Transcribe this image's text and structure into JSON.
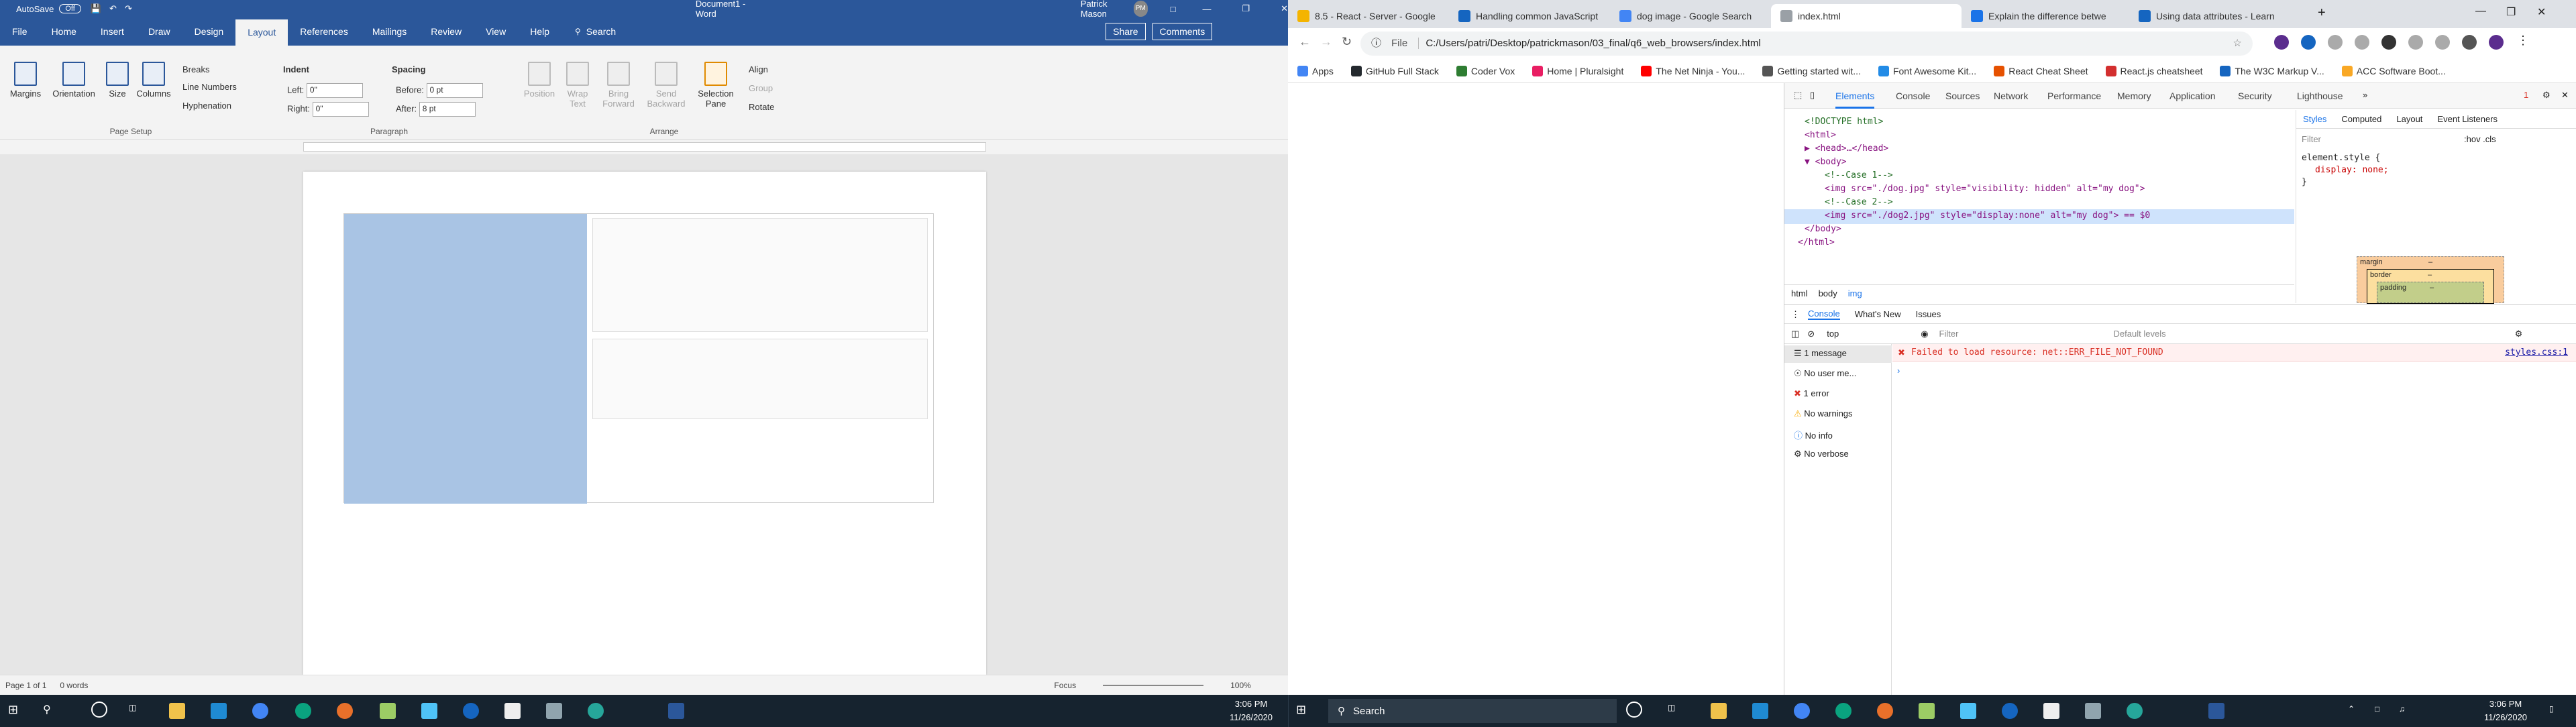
{
  "word": {
    "autosave_label": "AutoSave",
    "autosave_state": "Off",
    "doc_title": "Document1 - Word",
    "user_name": "Patrick Mason",
    "user_initials": "PM",
    "menu_tabs": [
      "File",
      "Home",
      "Insert",
      "Draw",
      "Design",
      "Layout",
      "References",
      "Mailings",
      "Review",
      "View",
      "Help"
    ],
    "search_label": "Search",
    "share_label": "Share",
    "comments_label": "Comments",
    "ribbon": {
      "margins": "Margins",
      "orientation": "Orientation",
      "size": "Size",
      "columns": "Columns",
      "breaks": "Breaks",
      "line_numbers": "Line Numbers",
      "hyphenation": "Hyphenation",
      "page_setup": "Page Setup",
      "indent": "Indent",
      "left": "Left:",
      "right": "Right:",
      "left_val": "0\"",
      "right_val": "0\"",
      "spacing": "Spacing",
      "before": "Before:",
      "after": "After:",
      "before_val": "0 pt",
      "after_val": "8 pt",
      "paragraph": "Paragraph",
      "position": "Position",
      "wrap_text": "Wrap Text",
      "bring_forward": "Bring Forward",
      "send_backward": "Send Backward",
      "selection_pane": "Selection Pane",
      "align": "Align",
      "group": "Group",
      "rotate": "Rotate",
      "arrange": "Arrange"
    },
    "status": {
      "page": "Page 1 of 1",
      "words": "0 words",
      "focus": "Focus",
      "zoom": "100%"
    }
  },
  "chrome": {
    "tabs": [
      {
        "label": "8.5 - React - Server - Google",
        "color": "#f4b400"
      },
      {
        "label": "Handling common JavaScript",
        "color": "#1565c0"
      },
      {
        "label": "dog image - Google Search",
        "color": "#4285f4"
      },
      {
        "label": "index.html",
        "color": "#9aa0a6"
      },
      {
        "label": "Explain the difference betwe",
        "color": "#1a73e8"
      },
      {
        "label": "Using data attributes - Learn",
        "color": "#1565c0"
      }
    ],
    "url_prefix": "File",
    "url": "C:/Users/patri/Desktop/patrickmason/03_final/q6_web_browsers/index.html",
    "bookmarks": [
      {
        "label": "Apps",
        "color": "#4285f4"
      },
      {
        "label": "GitHub Full Stack",
        "color": "#24292e"
      },
      {
        "label": "Coder Vox",
        "color": "#2e7d32"
      },
      {
        "label": "Home | Pluralsight",
        "color": "#e91e63"
      },
      {
        "label": "The Net Ninja - You...",
        "color": "#ff0000"
      },
      {
        "label": "Getting started wit...",
        "color": "#555555"
      },
      {
        "label": "Font Awesome Kit...",
        "color": "#228be6"
      },
      {
        "label": "React Cheat Sheet",
        "color": "#e65100"
      },
      {
        "label": "React.js cheatsheet",
        "color": "#d32f2f"
      },
      {
        "label": "The W3C Markup V...",
        "color": "#1565c0"
      },
      {
        "label": "ACC Software Boot...",
        "color": "#f9a825"
      }
    ],
    "devtools": {
      "tabs": [
        "Elements",
        "Console",
        "Sources",
        "Network",
        "Performance",
        "Memory",
        "Application",
        "Security",
        "Lighthouse"
      ],
      "error_count": "1",
      "dom": [
        {
          "t": "<!DOCTYPE html>",
          "c": "cm"
        },
        {
          "t": "<html>",
          "c": "tag"
        },
        {
          "t": "▶ <head>…</head>",
          "c": "tag"
        },
        {
          "t": "▼ <body>",
          "c": "tag"
        },
        {
          "t": "<!--Case 1-->",
          "c": "cm"
        },
        {
          "t": "<img src=\"./dog.jpg\" style=\"visibility: hidden\" alt=\"my dog\">",
          "c": "tag"
        },
        {
          "t": "<!--Case 2-->",
          "c": "cm"
        },
        {
          "t": "<img src=\"./dog2.jpg\" style=\"display:none\" alt=\"my dog\"> == $0",
          "c": "tag"
        },
        {
          "t": "</body>",
          "c": "tag"
        },
        {
          "t": "</html>",
          "c": "tag"
        }
      ],
      "breadcrumbs": [
        "html",
        "body",
        "img"
      ],
      "styles_tabs": [
        "Styles",
        "Computed",
        "Layout",
        "Event Listeners"
      ],
      "filter": "Filter",
      "hov_cls": ":hov .cls",
      "element_style": "element.style {",
      "display_rule": "display: none;",
      "close_brace": "}",
      "box": {
        "margin": "margin",
        "border": "border",
        "padding": "padding",
        "dash": "–"
      },
      "drawer_tabs": [
        "Console",
        "What's New",
        "Issues"
      ],
      "context": "top",
      "console_filter": "Filter",
      "levels": "Default levels",
      "sidebar": [
        {
          "label": "1 message",
          "icon": "list-icon"
        },
        {
          "label": "No user me...",
          "icon": "user-icon"
        },
        {
          "label": "1 error",
          "icon": "error-icon"
        },
        {
          "label": "No warnings",
          "icon": "warning-icon"
        },
        {
          "label": "No info",
          "icon": "info-icon"
        },
        {
          "label": "No verbose",
          "icon": "verbose-icon"
        }
      ],
      "error_msg": "Failed to load resource: net::ERR_FILE_NOT_FOUND",
      "error_src": "styles.css:1"
    }
  },
  "taskbar": {
    "search_label": "Search",
    "time": "3:06 PM",
    "date": "11/26/2020"
  }
}
